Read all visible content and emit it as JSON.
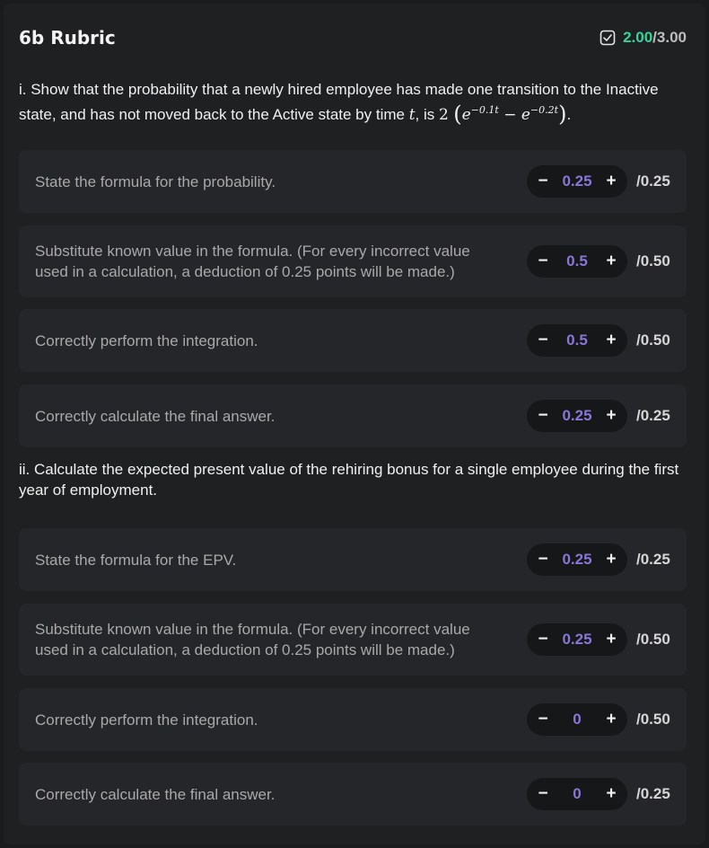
{
  "header": {
    "title": "6b Rubric",
    "score_got": "2.00",
    "score_sep": "/",
    "score_total": "3.00",
    "icon": "checkbox-check-icon"
  },
  "questions": [
    {
      "text_before": "i. Show that the probability that a newly hired employee has made one transition to the Inactive state, and has not moved back to the Active state by time ",
      "var": "t",
      "text_mid": ", is ",
      "coef": "2",
      "exp1": "−0.1t",
      "exp2": "−0.2t",
      "text_after": "."
    },
    {
      "text": "ii. Calculate the expected present value of the rehiring bonus for a single employee during the first year of employment."
    }
  ],
  "criteria_i": [
    {
      "desc": "State the formula for the probability.",
      "value": "0.25",
      "max": "/0.25"
    },
    {
      "desc": "Substitute known value in the formula. (For every incorrect value used in a calculation, a deduction of 0.25 points will be made.)",
      "value": "0.5",
      "max": "/0.50"
    },
    {
      "desc": "Correctly perform the integration.",
      "value": "0.5",
      "max": "/0.50"
    },
    {
      "desc": "Correctly calculate the final answer.",
      "value": "0.25",
      "max": "/0.25"
    }
  ],
  "criteria_ii": [
    {
      "desc": "State the formula for the EPV.",
      "value": "0.25",
      "max": "/0.25"
    },
    {
      "desc": "Substitute known value in the formula. (For every incorrect value used in a calculation, a deduction of 0.25 points will be made.)",
      "value": "0.25",
      "max": "/0.50"
    },
    {
      "desc": "Correctly perform the integration.",
      "value": "0",
      "max": "/0.50"
    },
    {
      "desc": "Correctly calculate the final answer.",
      "value": "0",
      "max": "/0.25"
    }
  ],
  "stepper": {
    "minus": "−",
    "plus": "+"
  },
  "colors": {
    "accent_green": "#37d39c",
    "accent_purple": "#8a76d8",
    "background": "#1f2022",
    "card": "#252629"
  }
}
